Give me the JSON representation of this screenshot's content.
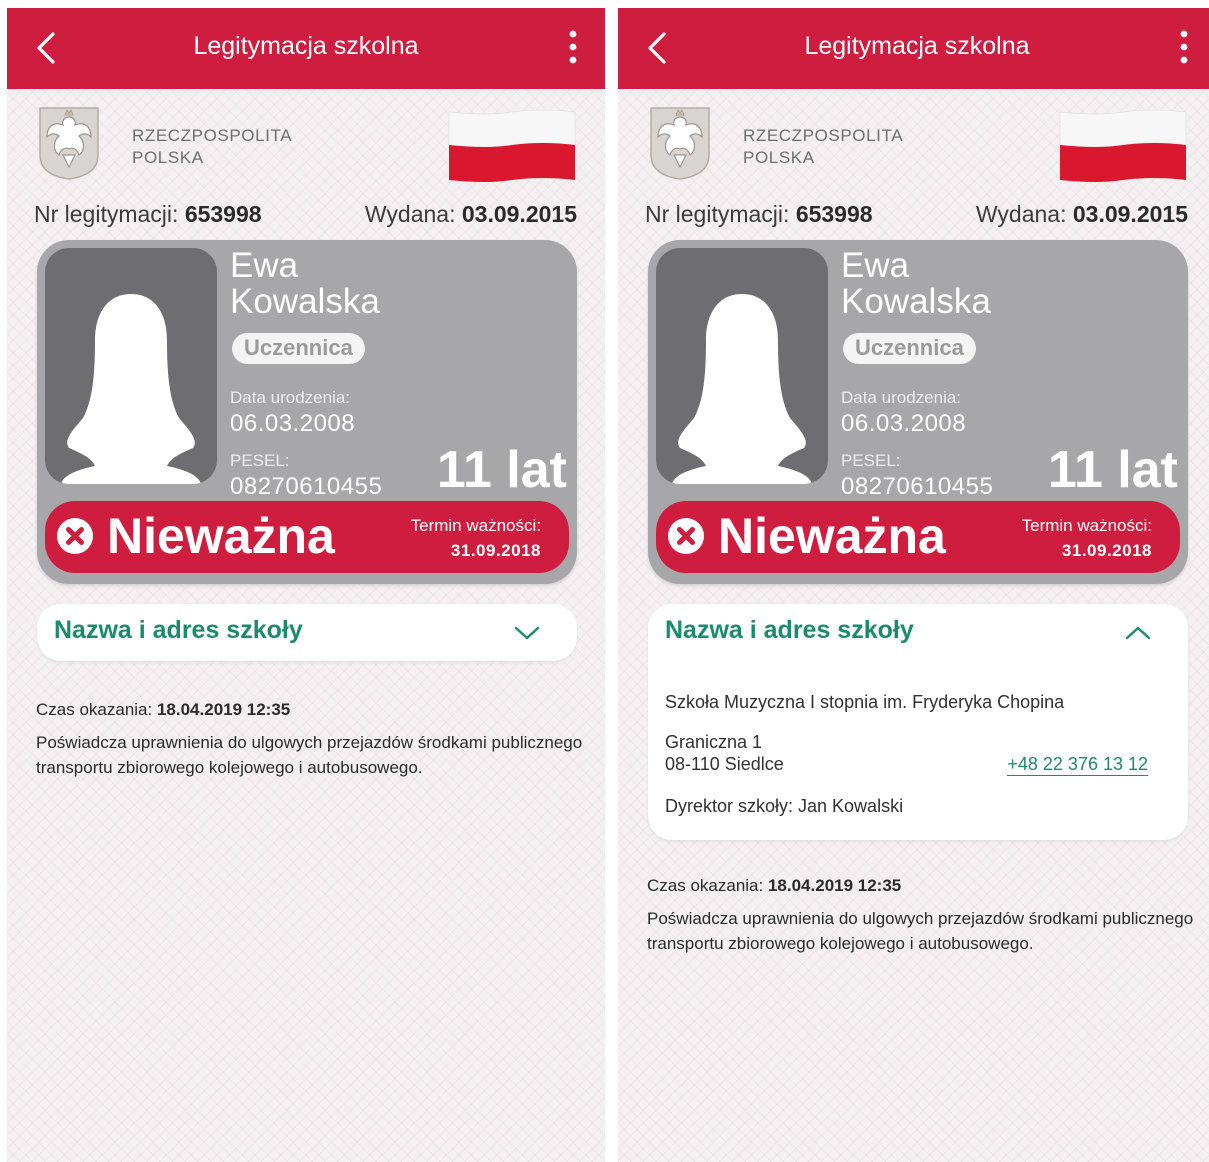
{
  "appbar": {
    "title": "Legitymacja szkolna",
    "back_icon": "chevron-left-icon",
    "menu_icon": "more-vertical-icon"
  },
  "header": {
    "country_line1": "RZECZPOSPOLITA",
    "country_line2": "POLSKA",
    "emblem_icon": "polish-eagle-emblem",
    "flag_icon": "polish-flag"
  },
  "id": {
    "number_label": "Nr legitymacji:",
    "number": "653998",
    "issued_label": "Wydana:",
    "issued_date": "03.09.2015"
  },
  "person": {
    "first_name": "Ewa",
    "last_name": "Kowalska",
    "role": "Uczennica",
    "birth_label": "Data urodzenia:",
    "birth_date": "06.03.2008",
    "pesel_label": "PESEL:",
    "pesel": "08270610455",
    "age": "11 lat"
  },
  "status": {
    "text": "Nieważna",
    "icon": "x-circle-icon",
    "expiry_label": "Termin ważności:",
    "expiry_date": "31.09.2018"
  },
  "school": {
    "section_title": "Nazwa i adres szkoły",
    "name": "Szkoła Muzyczna I stopnia im. Fryderyka Chopina",
    "street": "Graniczna 1",
    "city": "08-110 Siedlce",
    "phone": "+48 22 376 13 12",
    "director": "Dyrektor szkoły: Jan Kowalski"
  },
  "footer": {
    "shown_label": "Czas okazania:",
    "shown_value": "18.04.2019 12:35",
    "description": "Poświadcza uprawnienia do ulgowych przejazdów środkami publicznego transportu zbiorowego kolejowego i autobusowego."
  },
  "colors": {
    "brand_red": "#cf1d3f",
    "accent_green": "#1c8a6c",
    "card_gray": "#a7a7a9"
  }
}
